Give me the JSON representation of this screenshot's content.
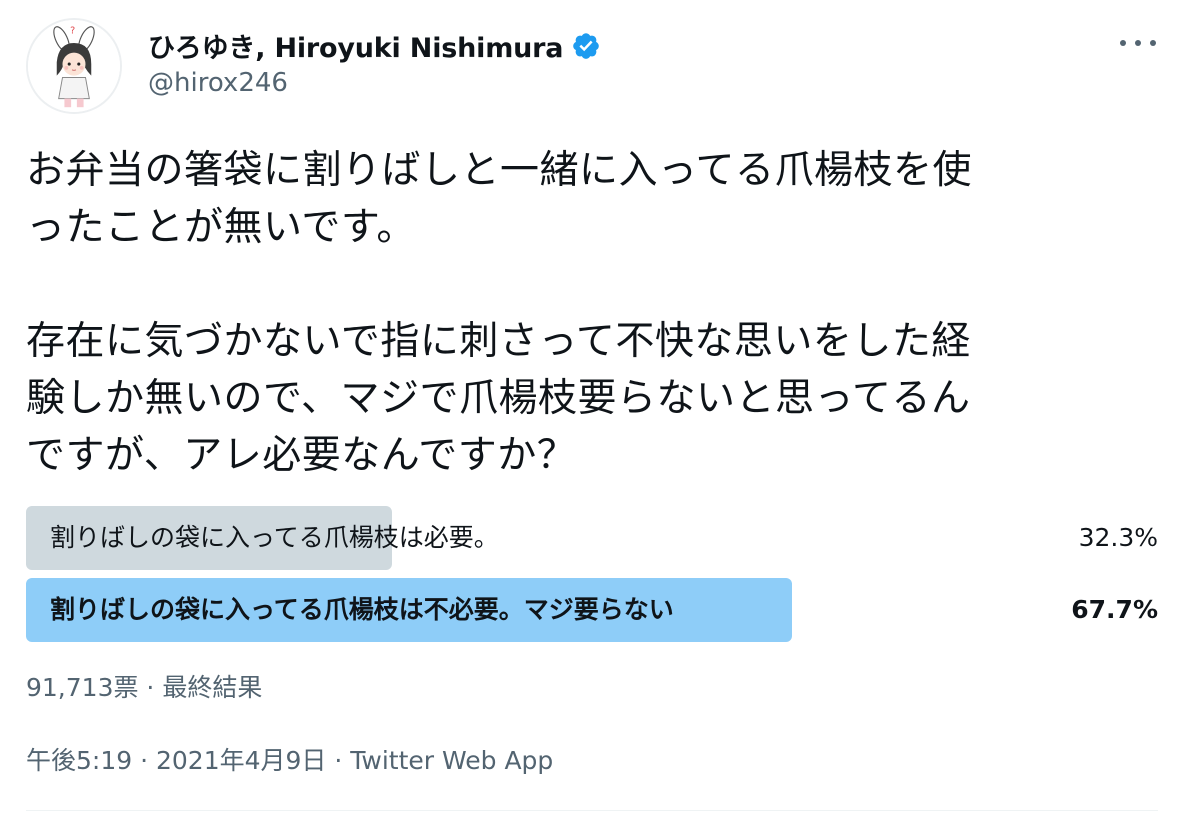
{
  "author": {
    "display_name": "ひろゆき, Hiroyuki Nishimura",
    "handle": "@hirox246",
    "verified": true,
    "avatar_icon": "avatar-illustration-icon"
  },
  "tweet": {
    "text": "お弁当の箸袋に割りばしと一緒に入ってる爪楊枝を使\nったことが無いです。\n\n存在に気づかないで指に刺さって不快な思いをした経\n験しか無いので、マジで爪楊枝要らないと思ってるん\nですが、アレ必要なんですか？"
  },
  "poll": {
    "options": [
      {
        "label": "割りばしの袋に入ってる爪楊枝は必要。",
        "percent": 32.3,
        "percent_text": "32.3%",
        "winner": false,
        "bar_color": "#cfd9de"
      },
      {
        "label": "割りばしの袋に入ってる爪楊枝は不必要。マジ要らない",
        "percent": 67.7,
        "percent_text": "67.7%",
        "winner": true,
        "bar_color": "#8ecdf8"
      }
    ],
    "votes": "91,713票",
    "separator": " · ",
    "status": "最終結果"
  },
  "meta": {
    "time": "午後5:19",
    "date": "2021年4月9日",
    "source": "Twitter Web App",
    "separator": " · "
  },
  "colors": {
    "verified_badge": "#1d9bf0",
    "secondary_text": "#536471"
  }
}
